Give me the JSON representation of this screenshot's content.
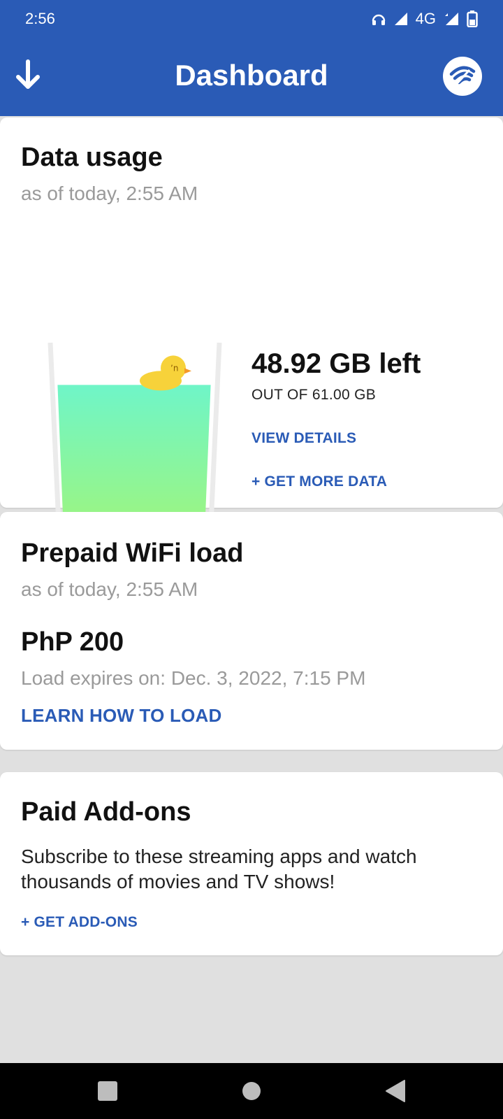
{
  "status_bar": {
    "time": "2:56",
    "network": "4G",
    "icons": [
      "headphones-icon",
      "cell-signal-icon",
      "wifi-signal-icon",
      "battery-icon"
    ]
  },
  "header": {
    "title": "Dashboard",
    "left_icon": "download-arrow-icon",
    "right_icon": "wifi-logo-icon",
    "color": "#2a5bb6"
  },
  "data_usage": {
    "title": "Data usage",
    "as_of": "as of today, 2:55 AM",
    "remaining": "48.92 GB left",
    "total": "OUT OF 61.00 GB",
    "remaining_fraction": 0.8,
    "view_details": "VIEW DETAILS",
    "get_more": "+ GET MORE DATA"
  },
  "prepaid": {
    "title": "Prepaid WiFi load",
    "as_of": "as of today, 2:55 AM",
    "amount": "PhP 200",
    "expires": "Load expires on: Dec. 3, 2022, 7:15 PM",
    "learn": "LEARN HOW TO LOAD"
  },
  "addons": {
    "title": "Paid Add-ons",
    "description": "Subscribe to these streaming apps and watch thousands of movies and TV shows!",
    "get_addons": "+ GET ADD-ONS"
  },
  "nav_bar": {
    "icons": [
      "recents-square-icon",
      "home-circle-icon",
      "back-triangle-icon"
    ]
  }
}
